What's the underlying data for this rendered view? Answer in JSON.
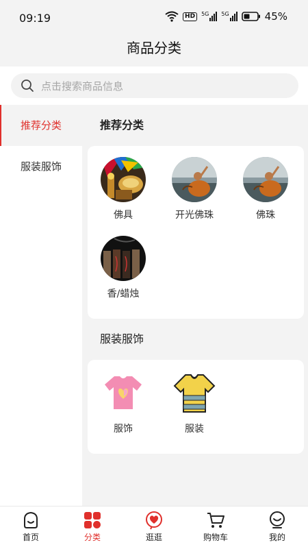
{
  "status_bar": {
    "time": "09:19",
    "hd": "HD",
    "net1": "5G",
    "net2": "5G",
    "battery": "45%"
  },
  "header": {
    "title": "商品分类"
  },
  "search": {
    "placeholder": "点击搜索商品信息"
  },
  "sidebar": {
    "items": [
      {
        "label": "推荐分类",
        "active": true
      },
      {
        "label": "服装服饰",
        "active": false
      }
    ]
  },
  "sections": [
    {
      "title": "推荐分类",
      "items": [
        {
          "label": "佛具"
        },
        {
          "label": "开光佛珠"
        },
        {
          "label": "佛珠"
        },
        {
          "label": "香/蜡烛"
        }
      ]
    },
    {
      "title": "服装服饰",
      "items": [
        {
          "label": "服饰"
        },
        {
          "label": "服装"
        }
      ]
    }
  ],
  "tabbar": {
    "items": [
      {
        "label": "首页",
        "icon": "home-icon",
        "active": false
      },
      {
        "label": "分类",
        "icon": "category-icon",
        "active": true
      },
      {
        "label": "逛逛",
        "icon": "browse-heart-icon",
        "active": false
      },
      {
        "label": "购物车",
        "icon": "cart-icon",
        "active": false
      },
      {
        "label": "我的",
        "icon": "profile-icon",
        "active": false
      }
    ]
  },
  "colors": {
    "accent": "#e0302c",
    "background": "#f3f3f3",
    "card": "#ffffff"
  }
}
